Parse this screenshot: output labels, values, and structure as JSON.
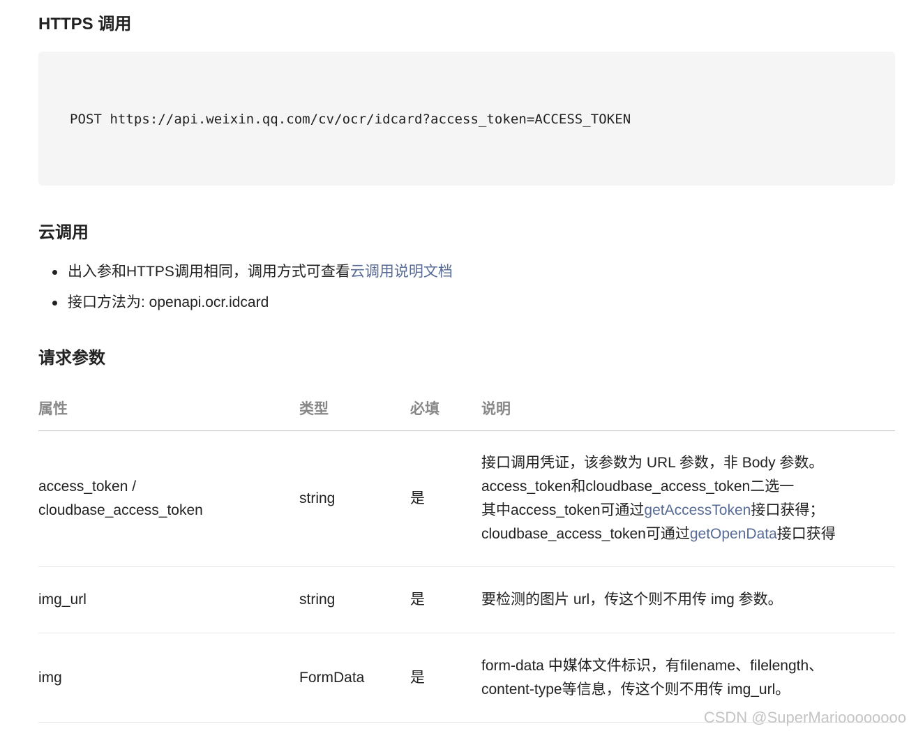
{
  "https_section": {
    "heading": "HTTPS 调用",
    "code": "POST https://api.weixin.qq.com/cv/ocr/idcard?access_token=ACCESS_TOKEN"
  },
  "cloud_section": {
    "heading": "云调用",
    "bullet1_text": "出入参和HTTPS调用相同，调用方式可查看",
    "bullet1_link": "云调用说明文档",
    "bullet2_text": "接口方法为: openapi.ocr.idcard"
  },
  "params_section": {
    "heading": "请求参数",
    "headers": [
      "属性",
      "类型",
      "必填",
      "说明"
    ],
    "rows": [
      {
        "name_line1": "access_token /",
        "name_line2": "cloudbase_access_token",
        "type": "string",
        "required": "是",
        "desc_line1": "接口调用凭证，该参数为 URL 参数，非 Body 参数。",
        "desc_line2": "access_token和cloudbase_access_token二选一",
        "desc_line3_pre": "其中access_token可通过",
        "desc_line3_link": "getAccessToken",
        "desc_line3_post": "接口获得；",
        "desc_line4_pre": "cloudbase_access_token可通过",
        "desc_line4_link": "getOpenData",
        "desc_line4_post": "接口获得"
      },
      {
        "name": "img_url",
        "type": "string",
        "required": "是",
        "desc": "要检测的图片 url，传这个则不用传 img 参数。"
      },
      {
        "name": "img",
        "type": "FormData",
        "required": "是",
        "desc_line1": "form-data 中媒体文件标识，有filename、filelength、",
        "desc_line2": "content-type等信息，传这个则不用传 img_url。"
      }
    ]
  },
  "watermark": "CSDN @SuperMarioooooooo",
  "colors": {
    "link": "#576b95",
    "code_bg": "#f5f5f6",
    "header_text": "#888888"
  }
}
